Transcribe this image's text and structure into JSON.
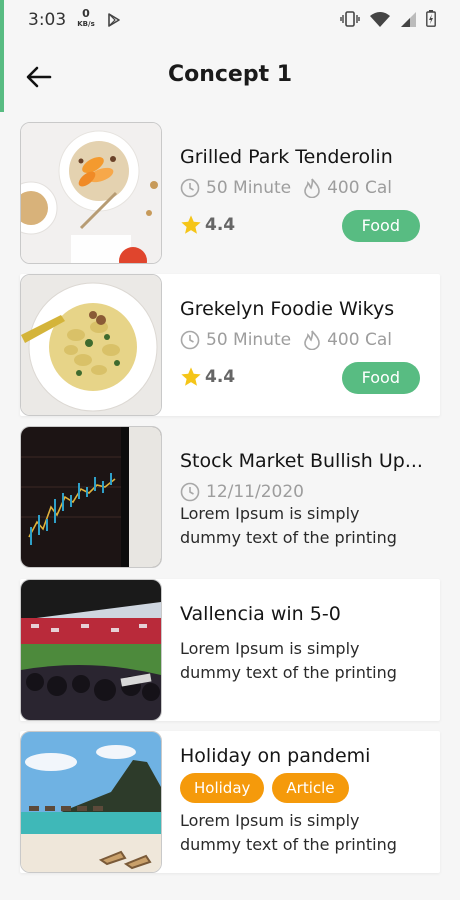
{
  "status": {
    "time": "3:03",
    "net_speed": "0",
    "net_unit": "KB/s"
  },
  "header": {
    "title": "Concept 1"
  },
  "cards": [
    {
      "title": "Grilled Park Tenderolin",
      "duration": "50 Minute",
      "calories": "400 Cal",
      "rating": "4.4",
      "tag": "Food"
    },
    {
      "title": "Grekelyn Foodie Wikys",
      "duration": "50 Minute",
      "calories": "400 Cal",
      "rating": "4.4",
      "tag": "Food"
    },
    {
      "title": "Stock Market Bullish Up...",
      "date": "12/11/2020",
      "desc_line1": "Lorem Ipsum is simply",
      "desc_line2": "dummy text of the printing"
    },
    {
      "title": "Vallencia win 5-0",
      "desc_line1": "Lorem Ipsum is simply",
      "desc_line2": "dummy text of the printing"
    },
    {
      "title": "Holiday on pandemi",
      "tags": [
        "Holiday",
        "Article"
      ],
      "desc_line1": "Lorem Ipsum is simply",
      "desc_line2": "dummy text of the printing"
    }
  ],
  "colors": {
    "accent_green": "#58bc82",
    "tag_orange": "#f59a0b",
    "star": "#f5c518",
    "muted": "#9d9d9d"
  },
  "icons": [
    "back-arrow-icon",
    "clock-icon",
    "flame-icon",
    "star-icon",
    "play-store-icon",
    "vibrate-icon",
    "wifi-icon",
    "signal-icon",
    "battery-icon"
  ]
}
